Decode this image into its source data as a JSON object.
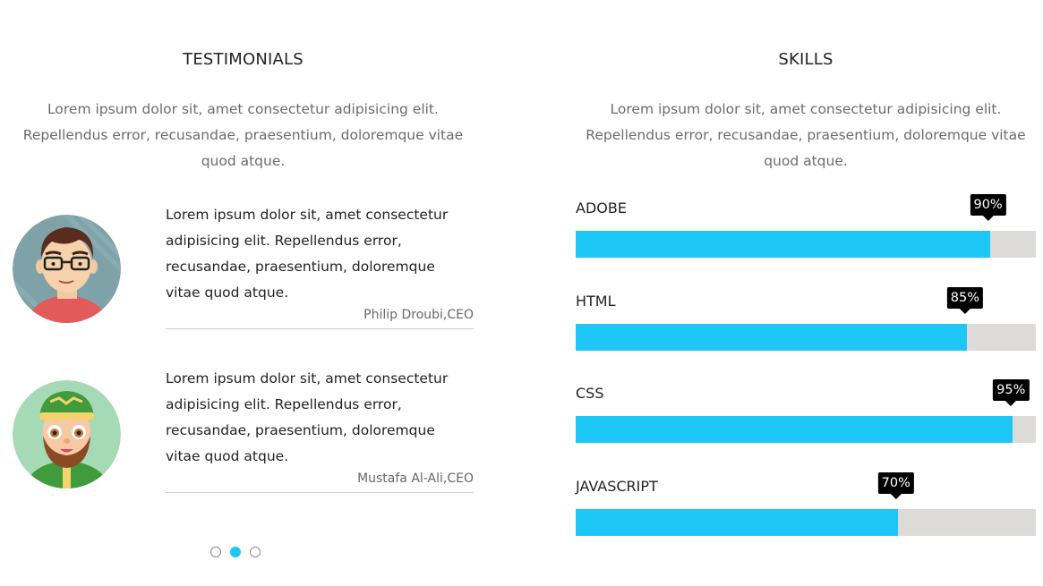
{
  "testimonials": {
    "title": "TESTIMONIALS",
    "intro": "Lorem ipsum dolor sit, amet consectetur adipisicing elit. Repellendus error, recusandae, praesentium, doloremque vitae quod atque.",
    "items": [
      {
        "quote": "Lorem ipsum dolor sit, amet consectetur adipisicing elit. Repellendus error, recusandae, praesentium, doloremque vitae quod atque.",
        "author": "Philip Droubi,CEO"
      },
      {
        "quote": "Lorem ipsum dolor sit, amet consectetur adipisicing elit. Repellendus error, recusandae, praesentium, doloremque vitae quod atque.",
        "author": "Mustafa Al-Ali,CEO"
      }
    ],
    "pagination": {
      "count": 3,
      "active_index": 1
    }
  },
  "skills": {
    "title": "SKILLS",
    "intro": "Lorem ipsum dolor sit, amet consectetur adipisicing elit. Repellendus error, recusandae, praesentium, doloremque vitae quod atque.",
    "items": [
      {
        "label": "ADOBE",
        "percent": 90,
        "percent_label": "90%"
      },
      {
        "label": "HTML",
        "percent": 85,
        "percent_label": "85%"
      },
      {
        "label": "CSS",
        "percent": 95,
        "percent_label": "95%"
      },
      {
        "label": "JAVASCRIPT",
        "percent": 70,
        "percent_label": "70%"
      }
    ]
  },
  "colors": {
    "accent": "#1ec6f6",
    "track": "#dddada",
    "badge": "#000000"
  }
}
